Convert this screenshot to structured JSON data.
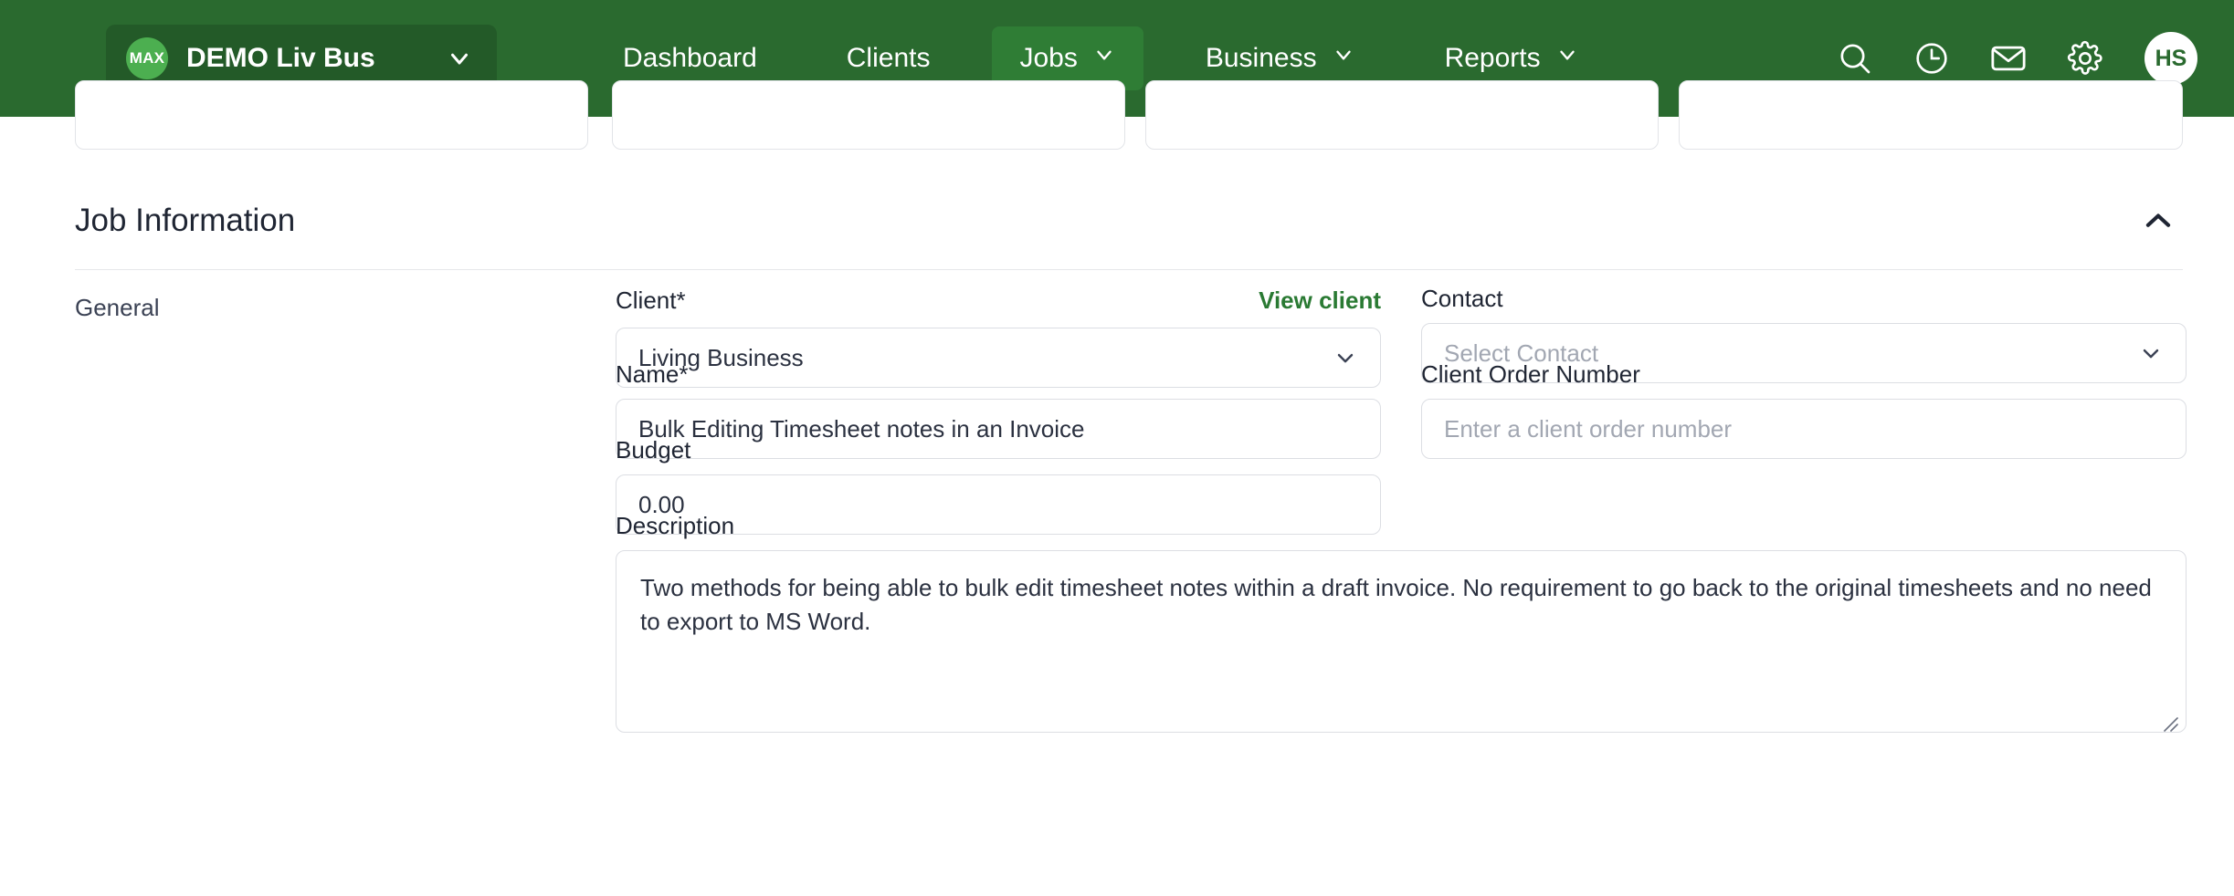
{
  "topnav": {
    "org": {
      "badge": "MAX",
      "name": "DEMO Liv Bus",
      "caret_icon": "chevron-down-icon"
    },
    "links": [
      {
        "label": "Dashboard",
        "has_caret": false,
        "active": false
      },
      {
        "label": "Clients",
        "has_caret": false,
        "active": false
      },
      {
        "label": "Jobs",
        "has_caret": true,
        "active": true
      },
      {
        "label": "Business",
        "has_caret": true,
        "active": false
      },
      {
        "label": "Reports",
        "has_caret": true,
        "active": false
      }
    ],
    "icons": [
      "search-icon",
      "recent-clock-icon",
      "mail-icon",
      "settings-gear-icon"
    ],
    "avatar_initials": "HS",
    "colors": {
      "bar": "#2a6a2f",
      "active_item": "#2f7d35",
      "org_pill": "#235a28",
      "badge": "#4caf50"
    }
  },
  "stat_cards_count": 4,
  "section": {
    "title": "Job Information",
    "collapse_icon": "chevron-up-icon"
  },
  "form": {
    "group_label": "General",
    "client": {
      "label": "Client",
      "required_mark": "*",
      "view_link": "View client",
      "value": "Living Business",
      "caret_icon": "chevron-down-icon"
    },
    "contact": {
      "label": "Contact",
      "value": "Select Contact",
      "is_placeholder": true,
      "caret_icon": "chevron-down-icon"
    },
    "name": {
      "label": "Name",
      "required_mark": "*",
      "value": "Bulk Editing Timesheet notes in an Invoice"
    },
    "client_order_number": {
      "label": "Client Order Number",
      "placeholder": "Enter a client order number",
      "value": ""
    },
    "budget": {
      "label": "Budget",
      "value": "0.00"
    },
    "description": {
      "label": "Description",
      "value": "Two methods for being able to bulk edit timesheet notes within a draft invoice.  No requirement to go back to the original timesheets and no need to export to MS Word.",
      "resize_icon": "resize-grip-icon"
    }
  },
  "colors": {
    "brand_green": "#2a6a2f",
    "link_green": "#2a7a33",
    "text_dark": "#1f2533",
    "border": "#dcdee3",
    "placeholder": "#a2a7b2"
  }
}
